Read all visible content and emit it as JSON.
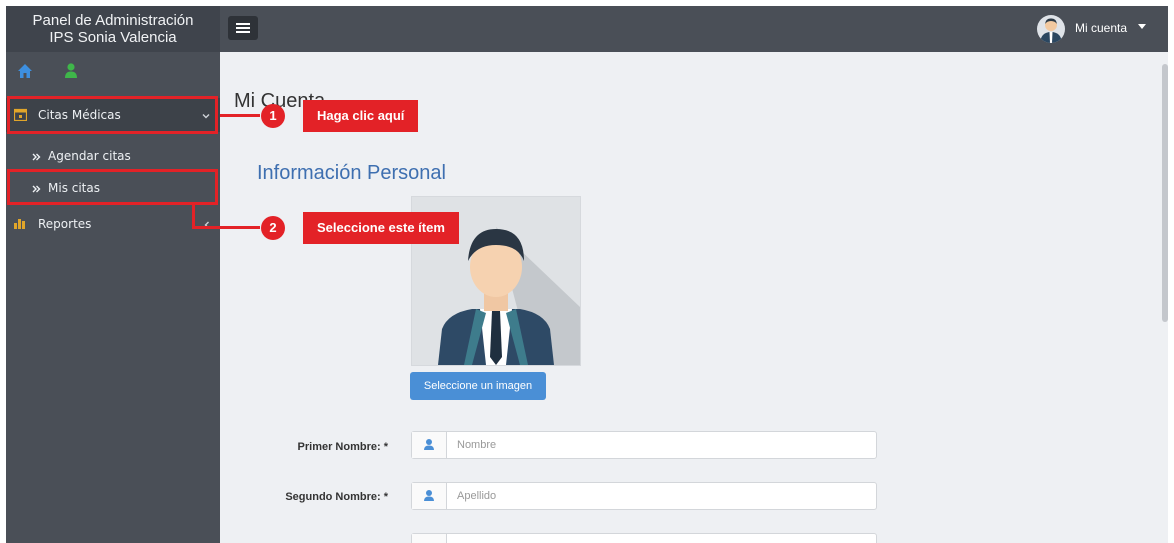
{
  "sidebar": {
    "brand_line1": "Panel de Administración",
    "brand_line2": "IPS Sonia Valencia",
    "quick_icons": [
      "home-icon",
      "user-icon"
    ],
    "items": [
      {
        "label": "Citas Médicas",
        "icon": "calendar-icon",
        "state": "expanded"
      },
      {
        "label": "Agendar citas",
        "icon": "double-chevron-right-icon"
      },
      {
        "label": "Mis citas",
        "icon": "double-chevron-right-icon"
      },
      {
        "label": "Reportes",
        "icon": "bar-chart-icon",
        "state": "collapsed"
      }
    ]
  },
  "topbar": {
    "account_label": "Mi cuenta",
    "menu_icon": "hamburger-icon"
  },
  "main": {
    "page_title": "Mi Cuenta",
    "section_title": "Información Personal",
    "image_button": "Seleccione un imagen",
    "fields": [
      {
        "label": "Primer Nombre: *",
        "placeholder": "Nombre",
        "icon": "user-icon"
      },
      {
        "label": "Segundo Nombre: *",
        "placeholder": "Apellido",
        "icon": "user-icon"
      }
    ]
  },
  "annotations": [
    {
      "number": "1",
      "text": "Haga clic aquí"
    },
    {
      "number": "2",
      "text": "Seleccione este ítem"
    }
  ],
  "colors": {
    "sidebar": "#4a4f57",
    "accent": "#e32227",
    "primary_button": "#4a8fd6",
    "section_title": "#3e6fb0"
  }
}
